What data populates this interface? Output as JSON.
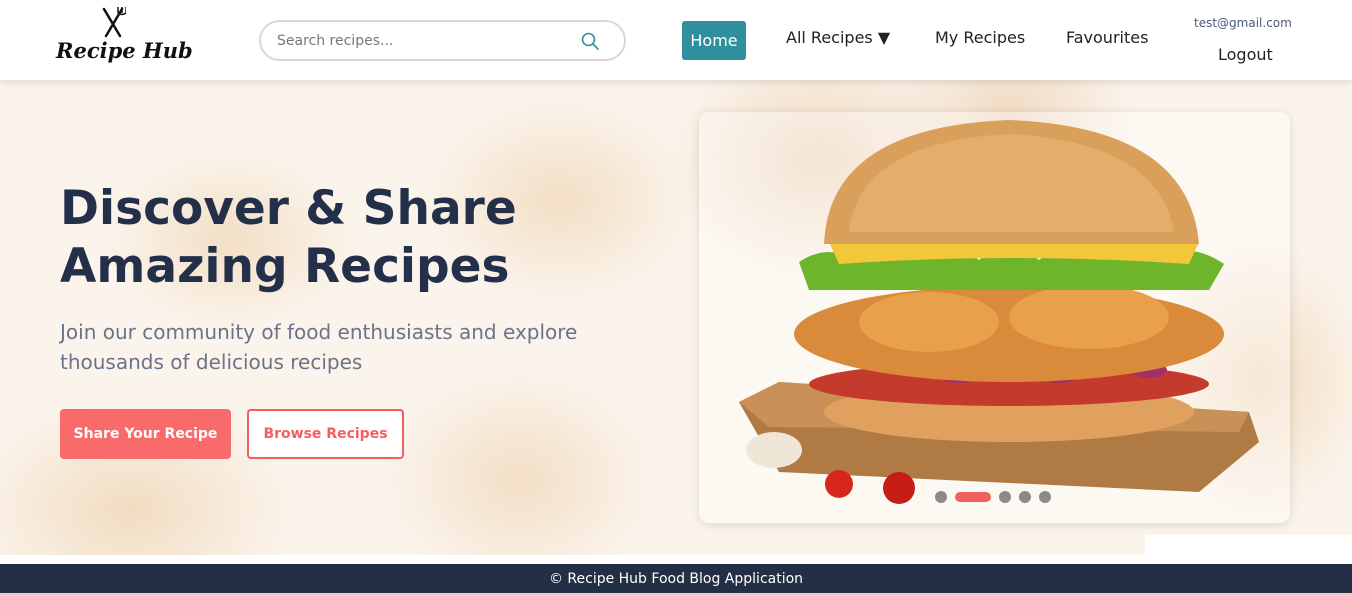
{
  "header": {
    "logo_text": "Recipe Hub",
    "search": {
      "placeholder": "Search recipes..."
    },
    "nav": {
      "home": "Home",
      "all_recipes": "All Recipes ▼",
      "my_recipes": "My Recipes",
      "favourites": "Favourites"
    },
    "user": {
      "email": "test@gmail.com",
      "logout": "Logout"
    }
  },
  "hero": {
    "title_line1": "Discover & Share",
    "title_line2": "Amazing Recipes",
    "subtitle": "Join our community of food enthusiasts and explore thousands of delicious recipes",
    "primary_button": "Share Your Recipe",
    "secondary_button": "Browse Recipes",
    "carousel": {
      "slide_count": 5,
      "active_index": 1
    }
  },
  "footer": {
    "text": "© Recipe Hub Food Blog Application"
  },
  "colors": {
    "accent_teal": "#2f8f9d",
    "accent_coral": "#f96a6a",
    "title_navy": "#24304a",
    "footer_bg": "#222f44"
  }
}
